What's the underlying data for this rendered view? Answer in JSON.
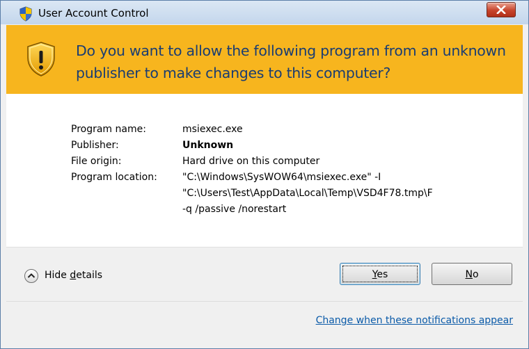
{
  "window": {
    "title": "User Account Control",
    "icon": "uac-shield-icon",
    "close_icon": "close-icon"
  },
  "banner": {
    "icon": "warning-shield-icon",
    "question": "Do you want to allow the following program from an unknown publisher to make changes to this computer?"
  },
  "details": {
    "program_name_label": "Program name:",
    "program_name": "msiexec.exe",
    "publisher_label": "Publisher:",
    "publisher": "Unknown",
    "file_origin_label": "File origin:",
    "file_origin": "Hard drive on this computer",
    "program_location_label": "Program location:",
    "program_location_lines": [
      "\"C:\\Windows\\SysWOW64\\msiexec.exe\"  -I",
      "\"C:\\Users\\Test\\AppData\\Local\\Temp\\VSD4F78.tmp\\F",
      "-q /passive /norestart"
    ]
  },
  "footer": {
    "toggle_icon": "chevron-up-icon",
    "hide_details_pre": "Hide ",
    "hide_details_key": "d",
    "hide_details_post": "etails",
    "yes_key": "Y",
    "yes_rest": "es",
    "no_key": "N",
    "no_rest": "o",
    "link": "Change when these notifications appear"
  },
  "colors": {
    "banner": "#f7b51e",
    "banner_text": "#1a3d72",
    "link": "#0a5aa8",
    "close_button": "#c7442b"
  }
}
